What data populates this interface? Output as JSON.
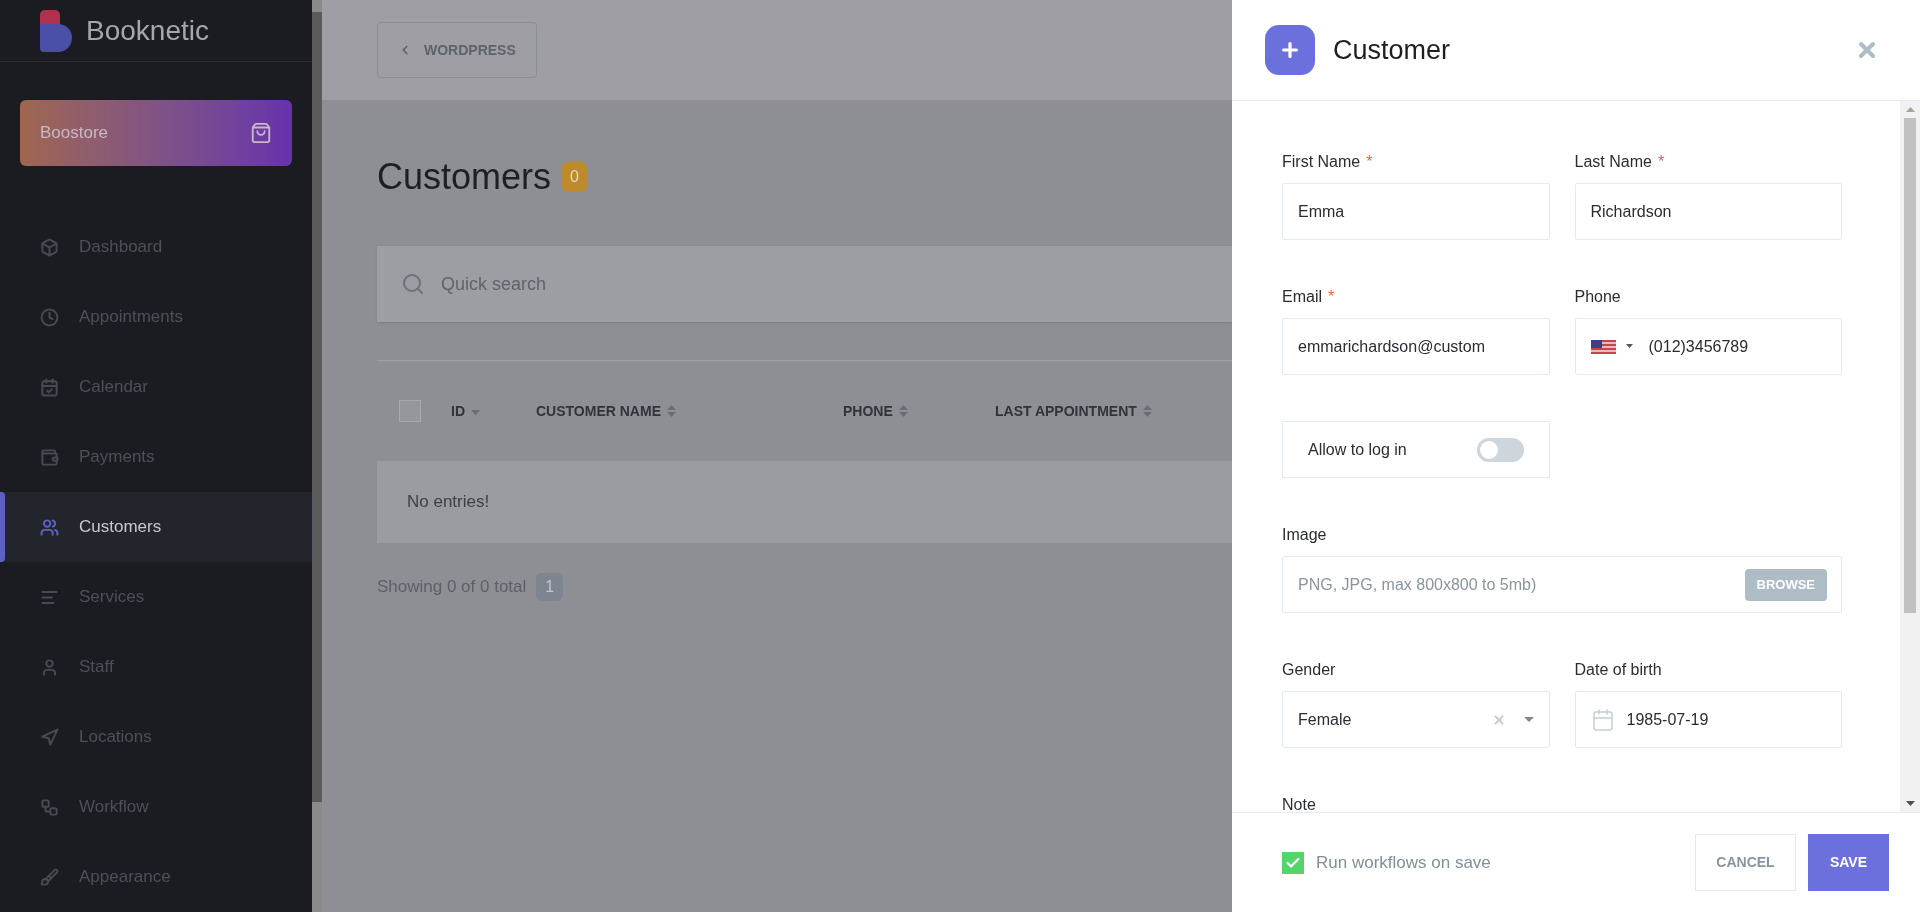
{
  "sidebar": {
    "logo": "Booknetic",
    "store_button": "Boostore",
    "items": [
      {
        "label": "Dashboard",
        "selected": false
      },
      {
        "label": "Appointments",
        "selected": false
      },
      {
        "label": "Calendar",
        "selected": false
      },
      {
        "label": "Payments",
        "selected": false
      },
      {
        "label": "Customers",
        "selected": true
      },
      {
        "label": "Services",
        "selected": false
      },
      {
        "label": "Staff",
        "selected": false
      },
      {
        "label": "Locations",
        "selected": false
      },
      {
        "label": "Workflow",
        "selected": false
      },
      {
        "label": "Appearance",
        "selected": false
      }
    ]
  },
  "main": {
    "back_button": "WORDPRESS",
    "title": "Customers",
    "count": "0",
    "search": {
      "placeholder": "Quick search"
    },
    "table": {
      "select_all_checked": false,
      "columns": [
        {
          "label": "ID",
          "kind": "sorted"
        },
        {
          "label": "CUSTOMER NAME",
          "kind": "sortable"
        },
        {
          "label": "PHONE",
          "kind": "sortable"
        },
        {
          "label": "LAST APPOINTMENT",
          "kind": "sortable"
        }
      ],
      "empty_text": "No entries!"
    },
    "footer": {
      "text": "Showing 0 of 0 total",
      "page": "1"
    }
  },
  "panel": {
    "title": "Customer",
    "fields": [
      {
        "kind": "text",
        "label": "First Name",
        "required_mark": "*",
        "value": "Emma"
      },
      {
        "kind": "text",
        "label": "Last Name",
        "required_mark": "*",
        "value": "Richardson"
      },
      {
        "kind": "text",
        "label": "Email",
        "required_mark": "*",
        "value": "emmarichardson@custom"
      },
      {
        "kind": "phone",
        "label": "Phone",
        "value": "(012)3456789"
      },
      {
        "kind": "toggle",
        "label": "Allow to log in",
        "on": false
      },
      {
        "kind": "file",
        "label": "Image",
        "placeholder": "PNG, JPG, max 800x800 to 5mb)",
        "button": "BROWSE"
      },
      {
        "kind": "select",
        "label": "Gender",
        "value": "Female"
      },
      {
        "kind": "date",
        "label": "Date of birth",
        "value": "1985-07-19"
      },
      {
        "kind": "note",
        "label": "Note"
      }
    ],
    "footer": {
      "checkbox": {
        "label": "Run workflows on save",
        "checked": true
      },
      "cancel": "CANCEL",
      "save": "SAVE"
    }
  }
}
